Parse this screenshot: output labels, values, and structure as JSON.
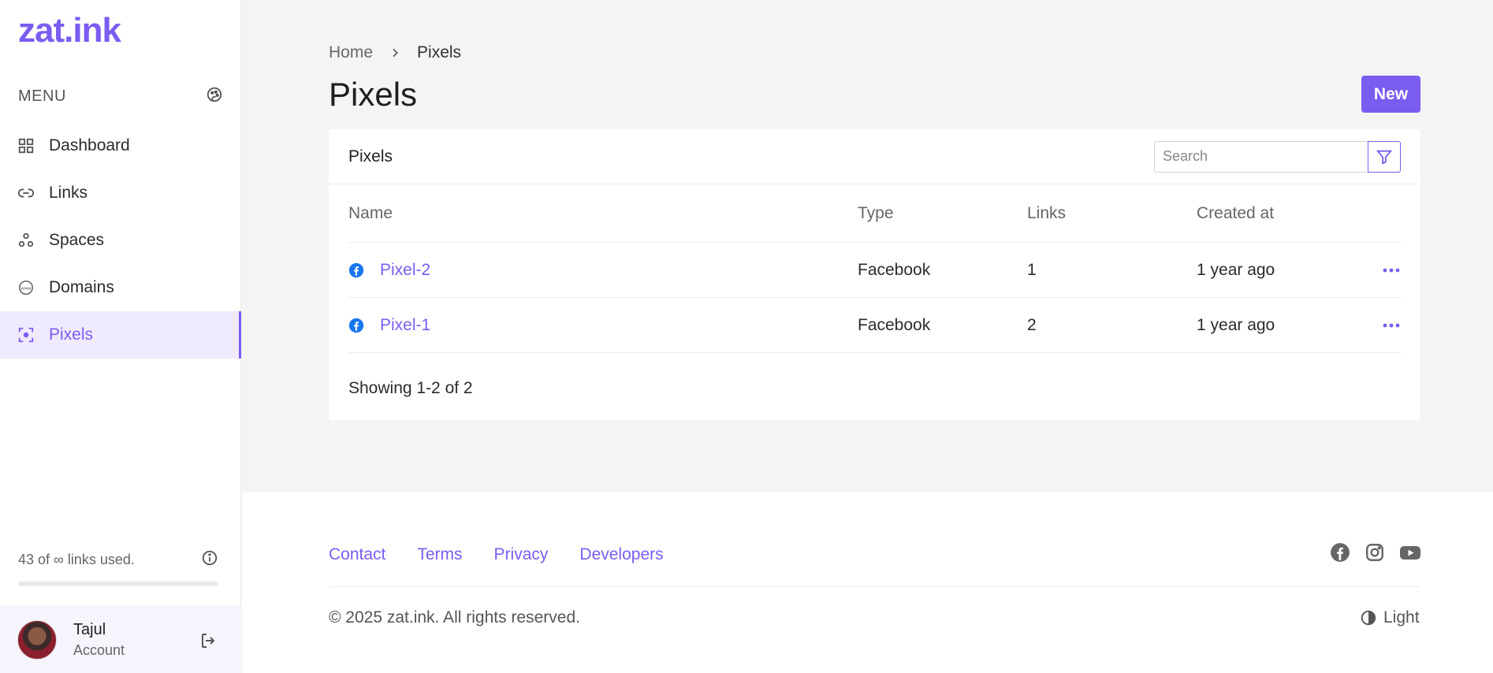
{
  "app": {
    "logo": "zat.ink"
  },
  "sidebar": {
    "menu_label": "MENU",
    "items": [
      {
        "label": "Dashboard",
        "icon": "grid-icon"
      },
      {
        "label": "Links",
        "icon": "link-icon"
      },
      {
        "label": "Spaces",
        "icon": "spaces-icon"
      },
      {
        "label": "Domains",
        "icon": "www-icon"
      },
      {
        "label": "Pixels",
        "icon": "pixel-focus-icon",
        "active": true
      }
    ],
    "usage": {
      "text": "43 of ∞ links used.",
      "fraction": 0
    },
    "account": {
      "name": "Tajul",
      "subtitle": "Account"
    }
  },
  "breadcrumb": {
    "home": "Home",
    "current": "Pixels"
  },
  "page": {
    "title": "Pixels",
    "new_button": "New"
  },
  "card": {
    "title": "Pixels",
    "search_placeholder": "Search",
    "columns": [
      "Name",
      "Type",
      "Links",
      "Created at"
    ],
    "rows": [
      {
        "name": "Pixel-2",
        "type": "Facebook",
        "links": "1",
        "created": "1 year ago"
      },
      {
        "name": "Pixel-1",
        "type": "Facebook",
        "links": "2",
        "created": "1 year ago"
      }
    ],
    "showing": "Showing 1-2 of 2"
  },
  "footer": {
    "links": [
      "Contact",
      "Terms",
      "Privacy",
      "Developers"
    ],
    "social": [
      "facebook-icon",
      "instagram-icon",
      "youtube-icon"
    ],
    "copyright": "© 2025 zat.ink. All rights reserved.",
    "theme": "Light"
  },
  "colors": {
    "accent": "#7b5cf0",
    "facebook": "#1877f2",
    "active_bg": "#efeafd"
  }
}
